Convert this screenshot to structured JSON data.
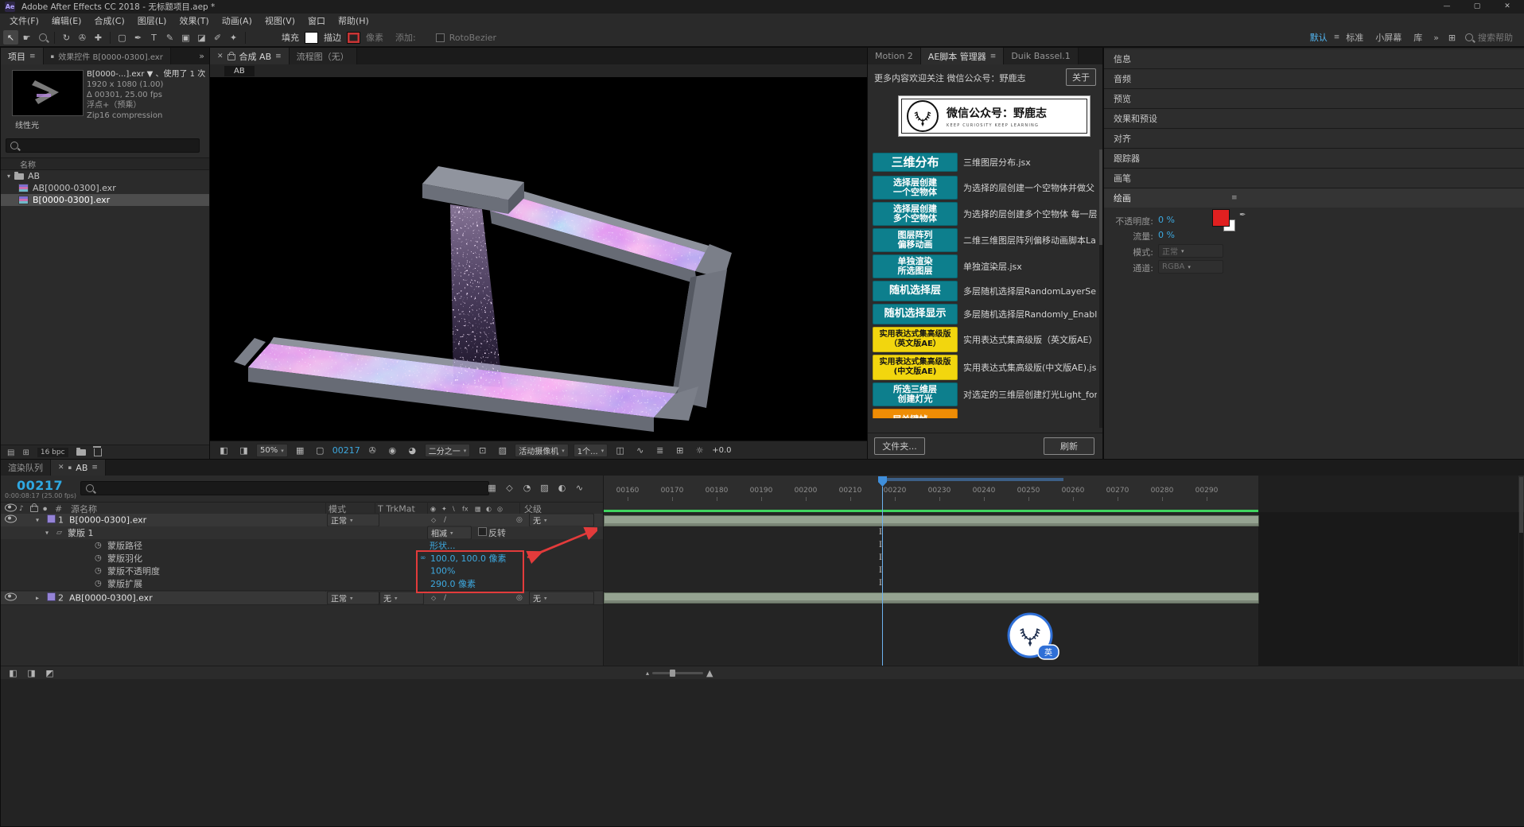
{
  "colors": {
    "accent_cyan": "#3da9e0",
    "script_teal": "#0d7f8d",
    "script_yellow": "#f2d60e",
    "script_orange": "#ef8d05",
    "annotation_red": "#e23b3b",
    "cache_green": "#3fd45f",
    "swatch_red": "#e02020",
    "playhead_blue": "#3f8fdc"
  },
  "window": {
    "icon": "Ae",
    "title": "Adobe After Effects CC 2018 - 无标题项目.aep *"
  },
  "menu": [
    "文件(F)",
    "编辑(E)",
    "合成(C)",
    "图层(L)",
    "效果(T)",
    "动画(A)",
    "视图(V)",
    "窗口",
    "帮助(H)"
  ],
  "toolbar": {
    "fill_label": "填充",
    "stroke_label": "描边",
    "stroke_unit": "像素",
    "add_label": "添加:",
    "rotobezier": "RotoBezier",
    "workspaces": [
      "默认",
      "标准",
      "小屏幕",
      "库"
    ],
    "search": "搜索帮助"
  },
  "project": {
    "tab": "项目",
    "tab_effect_controls": "效果控件 B[0000-0300].exr",
    "info_name": "B[0000-...].exr ▼",
    "info_usage": "、使用了 1 次",
    "info_lines": [
      "1920 x 1080 (1.00)",
      "∆ 00301, 25.00 fps",
      "浮点+（预乘）",
      "Zip16 compression"
    ],
    "color_note": "线性光",
    "name_col": "名称",
    "items": [
      {
        "name": "AB"
      },
      {
        "name": "AB[0000-0300].exr"
      },
      {
        "name": "B[0000-0300].exr"
      }
    ],
    "bpc": "16 bpc"
  },
  "comp": {
    "tab": "合成 AB",
    "tab2": "流程图（无）",
    "viewer": "AB",
    "zoom": "50%",
    "frame": "00217",
    "resolution": "二分之一",
    "view": "活动摄像机",
    "layout": "1个...",
    "exposure": "+0.0"
  },
  "scripts": {
    "tabs": [
      "Motion 2",
      "AE脚本 管理器",
      "Duik Bassel.1"
    ],
    "header": "更多内容欢迎关注 微信公众号：野鹿志",
    "about": "关于",
    "banner_title": "微信公众号：野鹿志",
    "banner_sub": "KEEP CURIOSITY KEEP LEARNING",
    "list": [
      {
        "label": "三维分布",
        "desc": "三维图层分布.jsx"
      },
      {
        "label": "选择层创建\n一个空物体",
        "desc": "为选择的层创建一个空物体并做父"
      },
      {
        "label": "选择层创建\n多个空物体",
        "desc": "为选择的层创建多个空物体 每一层"
      },
      {
        "label": "图层阵列\n偏移动画",
        "desc": "二维三维图层阵列偏移动画脚本La"
      },
      {
        "label": "单独渲染\n所选图层",
        "desc": "单独渲染层.jsx"
      },
      {
        "label": "随机选择层",
        "desc": "多层随机选择层RandomLayerSelector"
      },
      {
        "label": "随机选择显示",
        "desc": "多层随机选择层Randomly_Enable_Se"
      },
      {
        "label": "实用表达式集高级版\n（英文版AE）",
        "desc": "实用表达式集高级版（英文版AE）"
      },
      {
        "label": "实用表达式集高级版\n(中文版AE)",
        "desc": "实用表达式集高级版(中文版AE).jsx"
      },
      {
        "label": "所选三维层\n创建灯光",
        "desc": "对选定的三维层创建灯光Light_for_"
      },
      {
        "label": "层关键帧...",
        "desc": ""
      }
    ],
    "folder": "文件夹...",
    "refresh": "刷新"
  },
  "panels": {
    "stack": [
      "信息",
      "音频",
      "预览",
      "效果和预设",
      "对齐",
      "跟踪器",
      "画笔"
    ],
    "paint": {
      "title": "绘画",
      "opacity_label": "不透明度:",
      "opacity": "0 %",
      "flow_label": "流量:",
      "flow": "0 %",
      "mode_label": "模式:",
      "mode": "正常",
      "channel_label": "通道:",
      "channel": "RGBA"
    }
  },
  "timeline": {
    "tab_queue": "渲染队列",
    "tab_comp": "AB",
    "timecode": "00217",
    "timecode_sub": "0:00:08:17 (25.00 fps)",
    "col_hash": "#",
    "col_name": "源名称",
    "col_mode": "模式",
    "col_trkmat": "T TrkMat",
    "col_parent": "父级",
    "rows": {
      "layer1_num": "1",
      "layer1_name": "B[0000-0300].exr",
      "layer1_mode": "正常",
      "layer1_parent": "无",
      "mask_name": "蒙版 1",
      "mask_mode": "相减",
      "invert": "反转",
      "p1": "蒙版路径",
      "v1": "形状...",
      "p2": "蒙版羽化",
      "v2": "100.0, 100.0 像素",
      "p3": "蒙版不透明度",
      "v3": "100%",
      "p4": "蒙版扩展",
      "v4": "290.0 像素",
      "layer2_num": "2",
      "layer2_name": "AB[0000-0300].exr",
      "layer2_mode": "正常",
      "layer2_trkmat": "无",
      "layer2_parent": "无"
    },
    "ruler": [
      "00160",
      "00170",
      "00180",
      "00190",
      "00200",
      "00210",
      "00220",
      "00230",
      "00240",
      "00250",
      "00260",
      "00270",
      "00280",
      "00290"
    ],
    "badge": "英"
  },
  "glyphs": {
    "menu": "≡",
    "close": "✕",
    "min": "—",
    "max": "▢",
    "overflow": "»",
    "dot": "●",
    "sq": "▪",
    "sel": "↖",
    "hand": "☛",
    "rotate": "↻",
    "cam": "✇",
    "pan": "✚",
    "rect": "▢",
    "pen": "✒",
    "type": "T",
    "brush": "✎",
    "stamp": "▣",
    "eraser": "◪",
    "roto": "✐",
    "puppet": "✦",
    "spk": "♪",
    "watch": "◷",
    "link": "∞",
    "pick": "◎",
    "tw_o": "▾",
    "tw_c": "▸",
    "maskic": "▱",
    "diam": "◇",
    "slash": "/",
    "hdr1": "◉",
    "hdr2": "✦",
    "hdr3": "\\",
    "hdr4": "fx",
    "hdr5": "▦",
    "hdr6": "◐",
    "hdr7": "◎",
    "mon1": "◧",
    "mon2": "◨",
    "grid": "▦",
    "maskvis": "▢",
    "snap": "✇",
    "snap2": "◉",
    "chan": "◕",
    "roi": "⊡",
    "check": "▨",
    "tgt": "⊕",
    "pixa": "◫",
    "fastp": "∿",
    "tlb": "≣",
    "flowb": "⊞",
    "expo": "☼",
    "flow2": "▦",
    "d3": "◇",
    "shy": "◔",
    "fb": "▨",
    "mb": "◐",
    "ge": "∿",
    "exp1": "◧",
    "exp2": "◨",
    "exp3": "◩",
    "mtn_s": "▴",
    "mtn_l": "▲",
    "items": "▤"
  }
}
